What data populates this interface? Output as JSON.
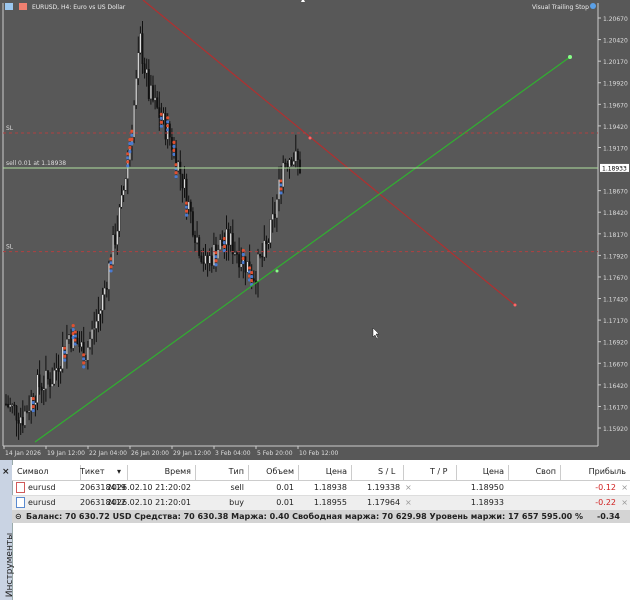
{
  "window": {
    "title": "EURUSD, H4:  Euro vs US Dollar",
    "ea_label": "Visual Trailing Stop"
  },
  "colors": {
    "bg": "#585858",
    "trend_red": "#b03030",
    "trend_green": "#30b030",
    "sl": "#b04040",
    "bid": "#b0e0a0"
  },
  "price_axis": [
    "1.20670",
    "1.20420",
    "1.20170",
    "1.19920",
    "1.19670",
    "1.19420",
    "1.19170",
    "1.18670",
    "1.18420",
    "1.18170",
    "1.17920",
    "1.17670",
    "1.17420",
    "1.17170",
    "1.16920",
    "1.16670",
    "1.16420",
    "1.16170",
    "1.15920"
  ],
  "bid_price": "1.18933",
  "time_axis": [
    "14 Jan 2026",
    "19 Jan 12:00",
    "22 Jan 04:00",
    "26 Jan 20:00",
    "29 Jan 12:00",
    "3 Feb 04:00",
    "5 Feb 20:00",
    "10 Feb 12:00"
  ],
  "sl_label": "SL",
  "order_label": "sell 0.01 at 1.18938",
  "price_path": [
    [
      0,
      1.162
    ],
    [
      8,
      1.1605
    ],
    [
      15,
      1.164
    ],
    [
      22,
      1.165
    ],
    [
      30,
      1.17
    ],
    [
      38,
      1.168
    ],
    [
      45,
      1.173
    ],
    [
      50,
      1.179
    ],
    [
      55,
      1.185
    ],
    [
      60,
      1.194
    ],
    [
      64,
      1.204
    ],
    [
      68,
      1.198
    ],
    [
      72,
      1.196
    ],
    [
      78,
      1.193
    ],
    [
      84,
      1.188
    ],
    [
      90,
      1.182
    ],
    [
      95,
      1.178
    ],
    [
      100,
      1.18
    ],
    [
      106,
      1.181
    ],
    [
      112,
      1.179
    ],
    [
      118,
      1.177
    ],
    [
      124,
      1.18
    ],
    [
      128,
      1.184
    ],
    [
      132,
      1.19
    ],
    [
      136,
      1.191
    ],
    [
      140,
      1.1895
    ]
  ],
  "table": {
    "columns": [
      "Символ",
      "Тикет",
      "Время",
      "Тип",
      "Объем",
      "Цена",
      "S / L",
      "T / P",
      "Цена",
      "Своп",
      "Прибыль"
    ],
    "rows": [
      [
        "eurusd",
        "206318419",
        "2026.02.10 21:20:02",
        "sell",
        "0.01",
        "1.18938",
        "1.19338",
        "",
        "1.18950",
        "",
        "-0.12"
      ],
      [
        "eurusd",
        "206318412",
        "2026.02.10 21:20:01",
        "buy",
        "0.01",
        "1.18955",
        "1.17964",
        "",
        "1.18933",
        "",
        "-0.22"
      ]
    ],
    "balance": "Баланс: 70 630.72 USD  Средства: 70 630.38  Маржа: 0.40  Свободная маржа: 70 629.98  Уровень маржи: 17 657 595.00 %",
    "total": "-0.34"
  },
  "side_tab": "Инструменты"
}
